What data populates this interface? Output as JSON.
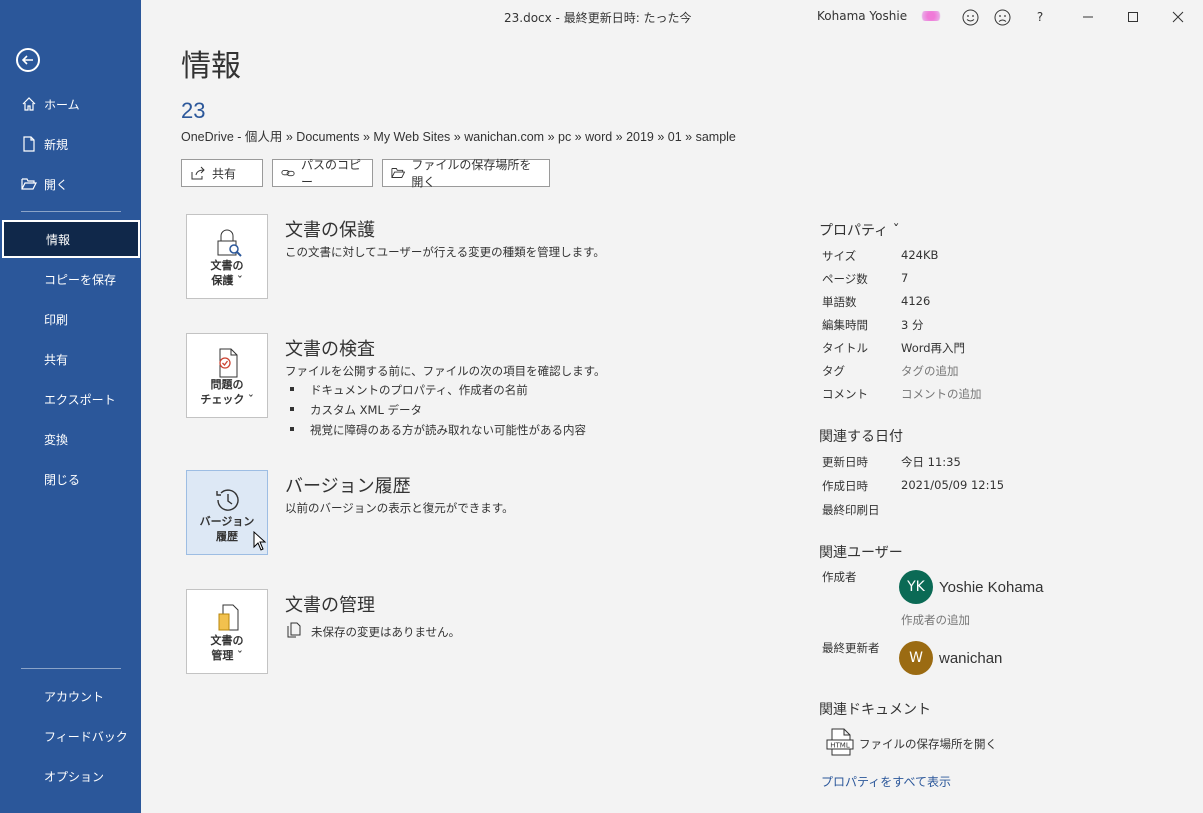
{
  "titlebar": {
    "doc_title": "23.docx  -  最終更新日時: たった今",
    "user_name": "Kohama Yoshie",
    "smiley_icon": "smiley-icon",
    "frown_icon": "frown-icon",
    "help": "?",
    "minimize": "—",
    "maximize": "☐",
    "close": "✕"
  },
  "sidebar": {
    "items": [
      {
        "label": "ホーム",
        "icon": "home-icon"
      },
      {
        "label": "新規",
        "icon": "new-doc-icon"
      },
      {
        "label": "開く",
        "icon": "folder-open-icon"
      },
      {
        "label": "情報"
      },
      {
        "label": "コピーを保存"
      },
      {
        "label": "印刷"
      },
      {
        "label": "共有"
      },
      {
        "label": "エクスポート"
      },
      {
        "label": "変換"
      },
      {
        "label": "閉じる"
      }
    ],
    "bottom": [
      {
        "label": "アカウント"
      },
      {
        "label": "フィードバック"
      },
      {
        "label": "オプション"
      }
    ]
  },
  "main": {
    "page_title": "情報",
    "doc_name": "23",
    "doc_path": "OneDrive - 個人用 » Documents » My Web Sites » wanichan.com » pc » word » 2019 » 01 » sample",
    "actions": [
      "共有",
      "パスのコピー",
      "ファイルの保存場所を開く"
    ],
    "sections": [
      {
        "tile_line1": "文書の",
        "tile_line2": "保護 ˇ",
        "title": "文書の保護",
        "desc": "この文書に対してユーザーが行える変更の種類を管理します。"
      },
      {
        "tile_line1": "問題の",
        "tile_line2": "チェック ˇ",
        "title": "文書の検査",
        "desc": "ファイルを公開する前に、ファイルの次の項目を確認します。",
        "bullets": [
          "ドキュメントのプロパティ、作成者の名前",
          "カスタム XML データ",
          "視覚に障碍のある方が読み取れない可能性がある内容"
        ]
      },
      {
        "tile_line1": "バージョン",
        "tile_line2": "履歴",
        "title": "バージョン履歴",
        "desc": "以前のバージョンの表示と復元ができます。"
      },
      {
        "tile_line1": "文書の",
        "tile_line2": "管理 ˇ",
        "title": "文書の管理",
        "desc": "未保存の変更はありません。"
      }
    ]
  },
  "properties": {
    "header": "プロパティ ˇ",
    "rows": [
      {
        "label": "サイズ",
        "value": "424KB"
      },
      {
        "label": "ページ数",
        "value": "7"
      },
      {
        "label": "単語数",
        "value": "4126"
      },
      {
        "label": "編集時間",
        "value": "3 分"
      },
      {
        "label": "タイトル",
        "value": "Word再入門"
      },
      {
        "label": "タグ",
        "value": "タグの追加"
      },
      {
        "label": "コメント",
        "value": "コメントの追加"
      }
    ],
    "dates_header": "関連する日付",
    "dates": [
      {
        "label": "更新日時",
        "value": "今日 11:35"
      },
      {
        "label": "作成日時",
        "value": "2021/05/09 12:15"
      },
      {
        "label": "最終印刷日",
        "value": ""
      }
    ],
    "people_header": "関連ユーザー",
    "author_label": "作成者",
    "author_initials": "YK",
    "author_name": "Yoshie Kohama",
    "author_color": "#0b6a55",
    "add_author": "作成者の追加",
    "modifier_label": "最終更新者",
    "modifier_initials": "W",
    "modifier_name": "wanichan",
    "modifier_color": "#9b6b12",
    "docs_header": "関連ドキュメント",
    "open_location": "ファイルの保存場所を開く",
    "show_all": "プロパティをすべて表示"
  }
}
